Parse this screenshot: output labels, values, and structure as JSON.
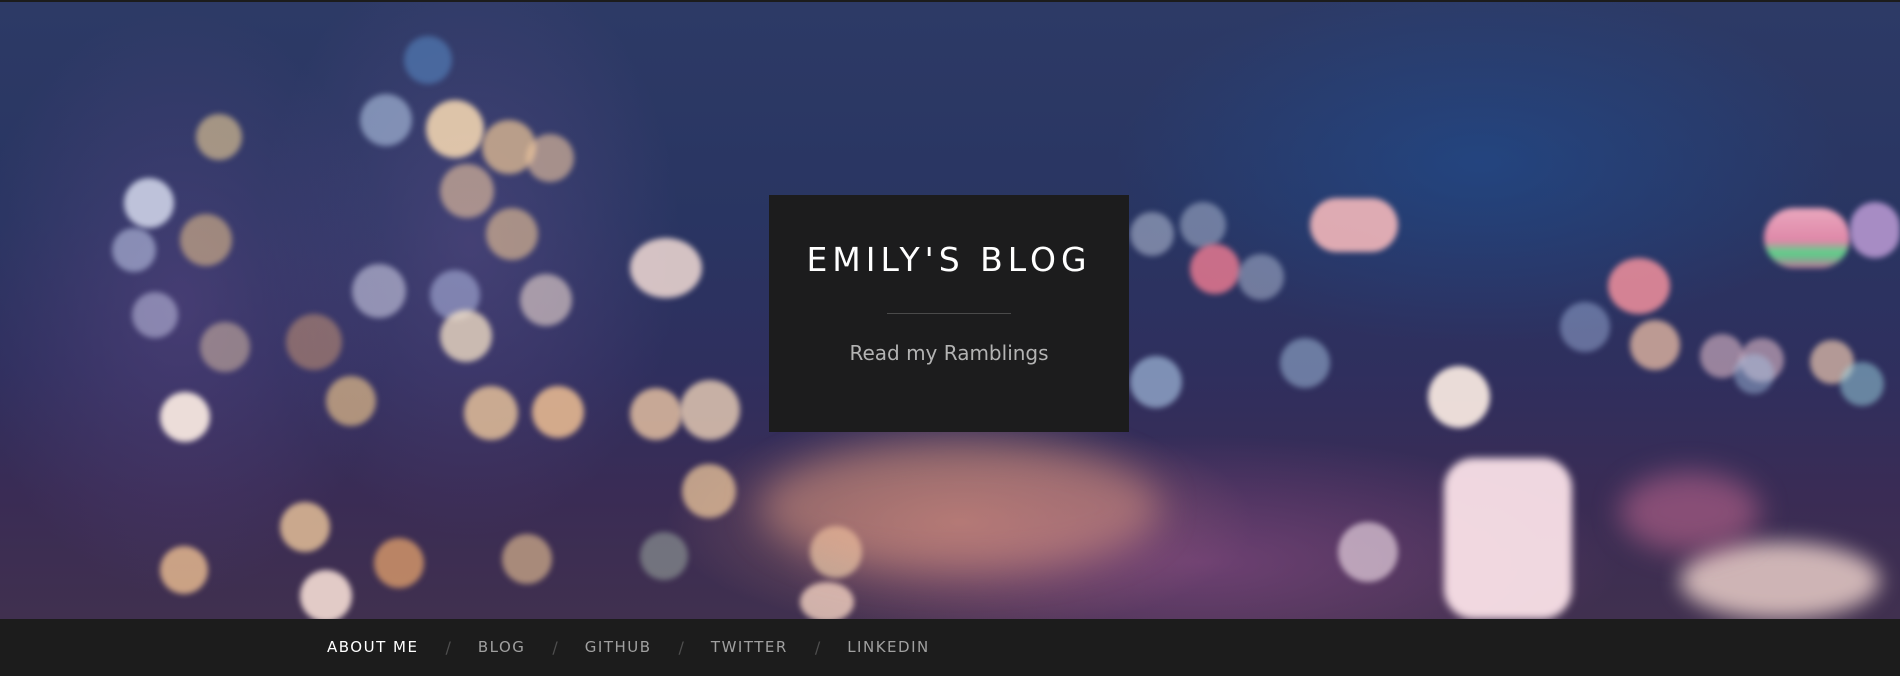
{
  "site": {
    "title": "EMILY'S BLOG",
    "tagline": "Read my Ramblings"
  },
  "nav": {
    "separator": "/",
    "items": [
      {
        "label": "ABOUT ME",
        "active": true
      },
      {
        "label": "BLOG",
        "active": false
      },
      {
        "label": "GITHUB",
        "active": false
      },
      {
        "label": "TWITTER",
        "active": false
      },
      {
        "label": "LINKEDIN",
        "active": false
      }
    ]
  },
  "colors": {
    "title_box_bg": "#1c1c1d",
    "nav_bg": "#1c1c1c",
    "nav_active": "#ffffff",
    "nav_inactive": "#a0a0a0"
  }
}
